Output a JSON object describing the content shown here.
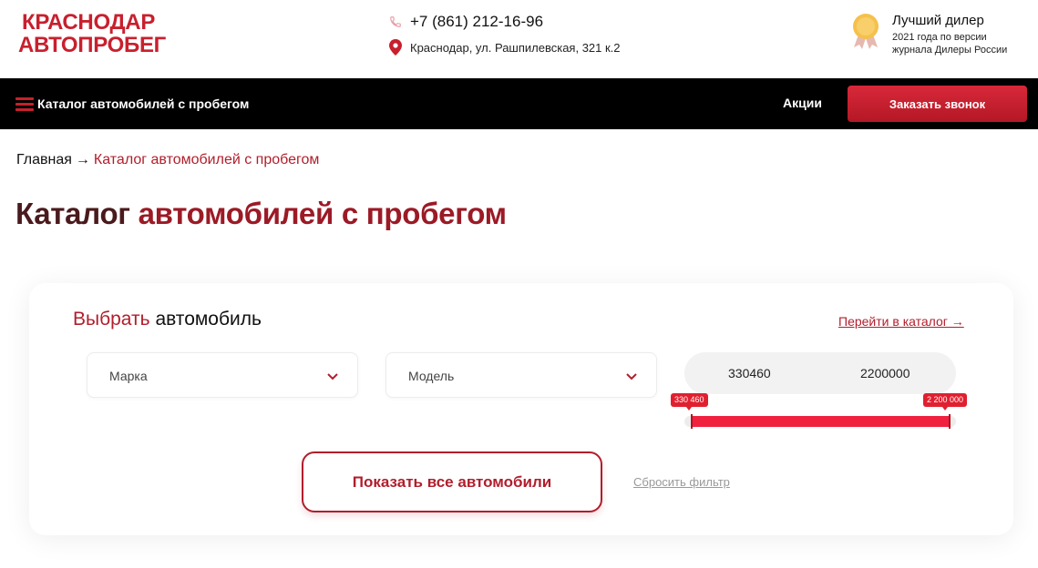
{
  "logo": {
    "line1": "КРАСНОДАР",
    "line2": "АВТОПРОБЕГ"
  },
  "contacts": {
    "phone": "+7 (861) 212-16-96",
    "address": "Краснодар, ул. Рашпилевская, 321 к.2",
    "phone_icon": "phone-icon",
    "address_icon": "location-pin-icon"
  },
  "award": {
    "title": "Лучший дилер",
    "line1": "2021 года по версии",
    "line2": "журнала Дилеры России",
    "icon": "medal-icon"
  },
  "nav": {
    "catalog_label": "Каталог автомобилей с пробегом",
    "promo_label": "Акции",
    "callback_label": "Заказать звонок",
    "menu_icon": "hamburger-icon"
  },
  "breadcrumb": {
    "home": "Главная",
    "separator": "→",
    "current": "Каталог автомобилей с пробегом"
  },
  "page": {
    "title_part1": "Каталог",
    "title_part2": "автомобилей с пробегом"
  },
  "filter": {
    "title_red": "Выбрать",
    "title_rest": "автомобиль",
    "goto_link": "Перейти в каталог →",
    "brand_placeholder": "Марка",
    "model_placeholder": "Модель",
    "price_from": "330460",
    "price_to": "2200000",
    "tip_min": "330 460",
    "tip_max": "2 200 000",
    "show_button": "Показать все автомобили",
    "reset_link": "Сбросить фильтр"
  },
  "colors": {
    "accent": "#c8202e",
    "dark_accent": "#9b1a26",
    "slider": "#f0213f",
    "navbar": "#000000"
  }
}
